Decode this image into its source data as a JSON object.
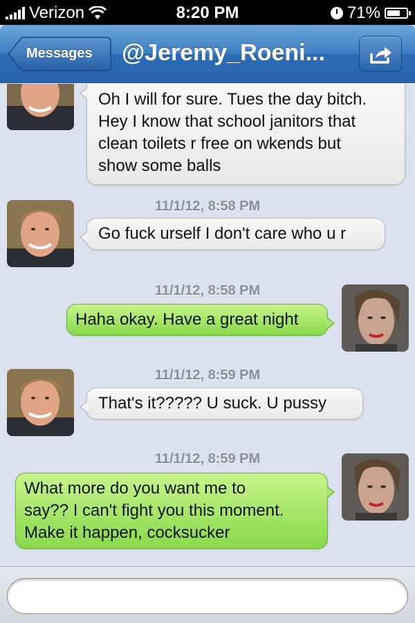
{
  "status_bar": {
    "carrier": "Verizon",
    "time": "8:20 PM",
    "battery": "71%",
    "battery_level": 0.71,
    "icons": [
      "signal-icon",
      "wifi-icon",
      "clock-icon",
      "battery-icon"
    ]
  },
  "nav": {
    "back_label": "Messages",
    "title": "@Jeremy_Roeni...",
    "share_icon": "share-icon",
    "bar_color": "#2f6fb6"
  },
  "messages": [
    {
      "direction": "in",
      "timestamp": "",
      "lines": [
        "Oh I will for sure. Tues the day bitch.",
        "Hey I know that school janitors that",
        "clean toilets r free on wkends but",
        "show some balls"
      ]
    },
    {
      "direction": "in",
      "timestamp": "11/1/12, 8:58 PM",
      "lines": [
        "Go fuck urself  I don't care who u r"
      ]
    },
    {
      "direction": "out",
      "timestamp": "11/1/12, 8:58 PM",
      "lines": [
        "Haha okay. Have a great night"
      ]
    },
    {
      "direction": "in",
      "timestamp": "11/1/12, 8:59 PM",
      "lines": [
        "That's it????? U suck.  U pussy"
      ]
    },
    {
      "direction": "out",
      "timestamp": "11/1/12, 8:59 PM",
      "lines": [
        "What more do you want me to",
        "say?? I can't fight you this moment.",
        "Make it happen, cocksucker"
      ]
    }
  ],
  "colors": {
    "incoming_bubble": "#f2f2f2",
    "outgoing_bubble": "#9fe05f",
    "background": "#dbe2ed"
  },
  "compose": {
    "value": "",
    "placeholder": ""
  }
}
